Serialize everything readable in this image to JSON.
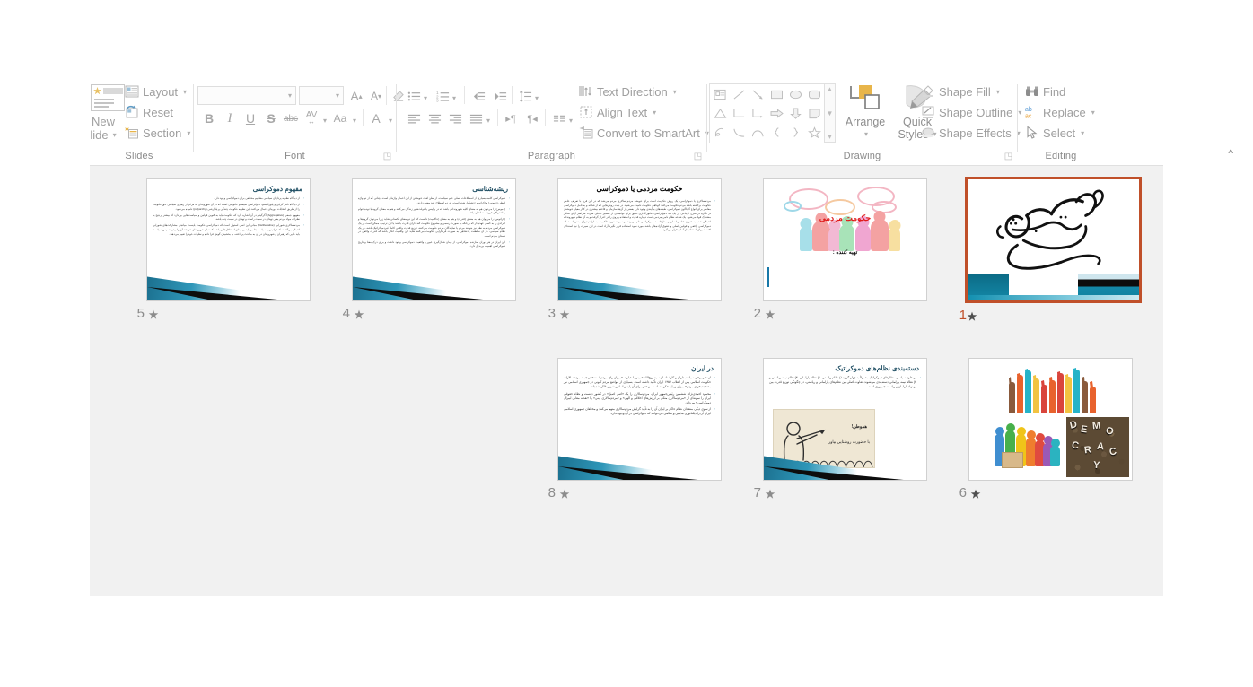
{
  "app": {
    "name": "Microsoft PowerPoint",
    "view": "slide-sorter"
  },
  "ribbon": {
    "groups": [
      {
        "id": "slides",
        "label": "Slides"
      },
      {
        "id": "font",
        "label": "Font"
      },
      {
        "id": "paragraph",
        "label": "Paragraph"
      },
      {
        "id": "drawing",
        "label": "Drawing"
      },
      {
        "id": "editing",
        "label": "Editing"
      }
    ],
    "slides_group": {
      "new_slide_label_line1": "New",
      "new_slide_label_line2": "lide",
      "layout_label": "Layout",
      "reset_label": "Reset",
      "section_label": "Section"
    },
    "font_group": {
      "font_name_value": "",
      "font_name_placeholder": "",
      "font_size_value": "",
      "font_size_placeholder": "",
      "increase_font_label": "A",
      "decrease_font_label": "A",
      "clear_formatting_label": "",
      "bold_label": "B",
      "italic_label": "I",
      "underline_label": "U",
      "shadow_label": "S",
      "strikethrough_label": "abc",
      "character_spacing_label": "AV",
      "change_case_label": "Aa",
      "font_color_label": "A"
    },
    "paragraph_group": {
      "text_direction_label": "Text Direction",
      "align_text_label": "Align Text",
      "convert_to_smartart_label": "Convert to SmartArt"
    },
    "drawing_group": {
      "arrange_label": "Arrange",
      "quick_styles_label_line1": "Quick",
      "quick_styles_label_line2": "Styles",
      "shape_fill_label": "Shape Fill",
      "shape_outline_label": "Shape Outline",
      "shape_effects_label": "Shape Effects"
    },
    "editing_group": {
      "find_label": "Find",
      "replace_label": "Replace",
      "select_label": "Select"
    },
    "collapse_ribbon_label": "^"
  },
  "colors": {
    "selection_border": "#C0502A",
    "selected_number": "#C0502A",
    "panel_background": "#F1F1F1",
    "slide_title_accent": "#1F4E63",
    "ribbon_text": "#9F9F9F",
    "red_title": "#E01B1B"
  },
  "slides": [
    {
      "number": "5",
      "selected": false,
      "type": "bullets",
      "title": "مفهوم دموکراسی",
      "bullets": [
        "از دیدگاه نظریه پردازان سیاسی مفاهیم مختلفی برای دموکراسی وجود دارد.",
        "از دیدگاه تکثر گرایی و پلورالیسم، دموکراسی سیستم حکومتی است که در آن شهروندان به فراتر از رهبری سیاسی حق حکومت را از طریق انتخابات دوره‌ای اعمال می‌کنند. این نظریه حکومت چندگی و پلوارشی (polyarchy) نامیده می‌شود.",
        "مفهوم جمعی (Aggregative) آگرگیتیو در آن اشاره دارد که حکومت باید به کنوین قوانین و سیاست‌هایی بپردازد که بیشتر ترجیح به نظرات مواد مردم یعنی تهدای در سمت راست و تهدای در سمت چپ باشد.",
        "مردم‌سالاری شورایی (Deliberative) مبانی این اصل استوار است که دموکراسی حکومت بایست میانجی مشارکت‌های شورایی اعمال می‌گشت که قوانینی و سیاست‌ها می‌باید بر مبنای استدلال‌هایی باشد که تمام شهروندان خواهند آن را بپذیرند، پس سیاست باید جایی که رهبران و شهروندان در آن به مباحث پرداخته، به بخشیدن گوش فرا داده و نظرات خود را تغییر می‌دهند."
      ]
    },
    {
      "number": "4",
      "selected": false,
      "type": "bullets",
      "title": "ریشه‌شناسی",
      "bullets": [
        "دموکراسی کلمه بسیاری از اسطلاحات اصلی علم سیاست، از بطن لغت خویشتن از این اعمال واژه‌ای است. چنانی که از دو واژه لفظی (دموس) و (کراتوس) تشکیل شده است، هر دو اصطلاح چند معنی دارند.",
        "(دموس) را می‌توان هم به معنای کلیه شهروندانی باشد که در پولیس یا دولت‌شهر زندگی می‌کنند و هم به معنای گروه یا توده عوام یا اشتراکی فرودست اشاره یافت.",
        "(کراتوس) را می‌توان هم به معنای (قدرت) و هم به معنای (حاکمیت) دانست که این دو معنای یکسانی شاید زیرا می‌توان گروه‌ها و افرادی را به کسی عهده‌دار که بی‌آنکه به صورت رسمی و مشروع حکومت کند دارای قدرت باشند یا این ترتیب، ممکن است در یک دموکراسی مردم به نظر نیز بتوانند مردم یا نمایندگان مردم حکومت می‌کنند، توزیع قدرت واقعی کاملاً غیردموکراتیک باشد، در یک نظام سیاسی، در آن سلطنت پادشاهی به صورت فردگرایی حکومت می‌کنند شاید این واقعیت انکار باشد که قدرت واقعی در دستان مردم است.",
        "این ایران در هر دوران سازنده دموکراسی، از زمان شکل‌گیری عبور و واقعیت دموکراسی وجود داشت و برای درک معنا و تاریخ دموکراسی اهمیت بی‌بدیل دارد."
      ]
    },
    {
      "number": "3",
      "selected": false,
      "type": "bullets",
      "title": "حکومت مردمی یا دموکراسی",
      "title_center": true,
      "bullets": [
        "مردم‌سالاری یا دموکراسی، یک روش حکومت است برای خویشه مردم سالاری مردم می‌شد که در این قرن با تعریف خاص حکومت برگشته باشد مردم حکومت می‌کنند کوتاهی حکومت نامیده می‌شود. در بابت روش‌هایی که از شاخه و به تأمل دموکراسی معاصر برای انواع گوناگون دموکراسی، طبقه‌های برآیندی وجود دارد بعضی از آن‌ها سازمان و قاعده بیشتری در کنار معیار خویشتن در نگاره در شرح ارجاعی در یک دید دموکراسی، قانون‌گذاری دقیق برای توانمندی از تفسیر داخلی قدرت سراسر آرای سالار مشترک قولا می‌شود. یک شاخه نظام نامی مردمی است دوباره قدرت و استفاده پیروی را در احراز گرفت و به آن نظام شهروندانه اعمالی شده به عنوان عناصر اصلی و مدل‌هاست دموکراسی نام می‌برند در سیرت دوره حاکمیت مساوات‌پذیران معنی است که دموکراسی واقعی و قوانین اصلی و حقوق آزاده‌های باشد. مورد سود استفاده قرار نگیرد آزاد است در این سیرت را نیز استدلال اقتصاد برای استفاده از آسان قرار می‌گیرد."
      ]
    },
    {
      "number": "2",
      "selected": false,
      "type": "title-people",
      "title": "حکومت مردمی",
      "subtitle": "تهیه کننده :"
    },
    {
      "number": "1",
      "selected": true,
      "type": "bismillah",
      "title": "بسم الله الرحمن الرحیم"
    },
    {
      "number": "8",
      "selected": false,
      "type": "bullets",
      "title": "در ایران",
      "bullets": [
        "از نظر برخی سیاستمداران و کارشناسان سید روح‌الله خمینی با عبارت «میزان رای مردم است» در جمله مردم‌سالارانه حکومت اسلامی پس از انقلاب ۱۳۵۷ ایران تأکید داشته است. بسیاری از مواضع مردم کنونی در جمهوری اسلامی نیز معتقدند «رای مردم» میزان و پایه حکومت است، و حتی برای آن پایه و اساس شبهی قائل شده‌اند.",
        "محمود احمدی‌نژاد، ششمین رئیس‌جمهور ایران، مردم‌سالاری را یک «اصل اصیل» در کشور دانست و نظام حقوقی ایران را نمونه‌ای از «مردم‌سالاری متکی بر ارزش‌های اخلاقی و الهی» و «مردم‌سالاری دینی» را «نقطه مقابل لیبرال دموکراسی» می‌داند.",
        "از سوی دیگر، منتقدان نظام حاکم بر ایران آن را به تأیید گرایش مردم‌سالاری متهم می‌کنند و مخالفان جمهوری اسلامی ایران آن را دیکتاتوری مذهبی و نظامی می‌خوانند که دموکراسی در آن وجود ندارد."
      ]
    },
    {
      "number": "7",
      "selected": false,
      "type": "bullets-image",
      "title": "دسته‌بندی نظام‌های دموکراتیک",
      "bullets": [
        "در علوم سیاسی، نظام‌های دموکراتیک معمولاً به چهار گروه ۱) نظام ریاستی، ۲) نظام پارلمانی، ۳) نظام نیمه ریاستی و ۴) نظام نیمه پارلمانی دسته‌بندی می‌شوند. تفاوت اصلی بین نظام‌های پارلمانی و ریاستی، در چگونگی توزیع قدرت بین دو نهاد پارلمان و ریاست جمهوری است."
      ],
      "image_caption_line1": "هموطن!",
      "image_caption_line2": "با حضورت روشنایی بیاور!"
    },
    {
      "number": "6",
      "selected": false,
      "type": "image-collage",
      "photo_word": "DEMOCRACY"
    }
  ]
}
